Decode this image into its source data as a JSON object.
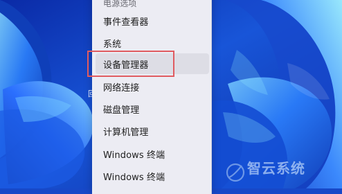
{
  "desktop": {
    "stub_text": "回"
  },
  "context_menu": {
    "partial_item_label": "电源选项",
    "items": [
      "事件查看器",
      "系统",
      "设备管理器",
      "网络连接",
      "磁盘管理",
      "计算机管理",
      "Windows 终端",
      "Windows 终端"
    ]
  },
  "watermark": {
    "text": "智云系统"
  },
  "colors": {
    "highlight_border": "#e05b60",
    "menu_background": "#ececf3",
    "desktop_blue": "#1748c8"
  }
}
